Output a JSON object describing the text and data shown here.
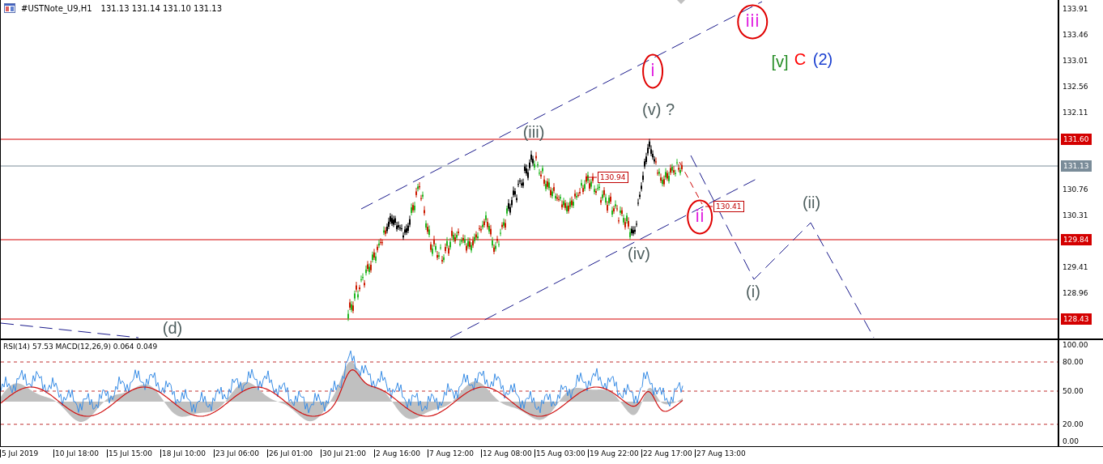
{
  "header": {
    "title": "#USTNote_U9,H1",
    "quote": "131.13 131.14 131.10 131.13"
  },
  "price_axis": [
    "133.91",
    "133.46",
    "133.01",
    "132.56",
    "132.11",
    "130.76",
    "130.31",
    "129.41",
    "128.96"
  ],
  "levels": [
    {
      "label": "131.60",
      "kind": "resistance"
    },
    {
      "label": "131.13",
      "kind": "current"
    },
    {
      "label": "129.84",
      "kind": "support"
    },
    {
      "label": "128.43",
      "kind": "support"
    }
  ],
  "price_tags": [
    "130.94",
    "130.41"
  ],
  "wave_labels": [
    {
      "text": "(iii)",
      "color": "#4f5f5f",
      "circled": false
    },
    {
      "text": "(v) ?",
      "color": "#4f5f5f",
      "circled": false
    },
    {
      "text": "(iv)",
      "color": "#4f5f5f",
      "circled": false
    },
    {
      "text": "i",
      "color": "#e020e0",
      "circled": true
    },
    {
      "text": "ii",
      "color": "#e020e0",
      "circled": true
    },
    {
      "text": "iii",
      "color": "#e020e0",
      "circled": true
    },
    {
      "text": "[v]",
      "color": "#228b22",
      "circled": false
    },
    {
      "text": "C",
      "color": "#ff0000",
      "circled": false
    },
    {
      "text": "(2)",
      "color": "#1a3fd0",
      "circled": false
    },
    {
      "text": "(ii)",
      "color": "#4f5f5f",
      "circled": false
    },
    {
      "text": "(i)",
      "color": "#4f5f5f",
      "circled": false
    },
    {
      "text": "(d)",
      "color": "#4f5f5f",
      "circled": false
    }
  ],
  "indicator": {
    "legend": "RSI(14) 57.53 MACD(12,26,9) 0.064 0.049",
    "ticks": [
      "100.00",
      "80.00",
      "50.00",
      "20.00",
      "0.00"
    ]
  },
  "time_axis": [
    "5 Jul 2019",
    "10 Jul 18:00",
    "15 Jul 15:00",
    "18 Jul 10:00",
    "23 Jul 06:00",
    "26 Jul 01:00",
    "30 Jul 21:00",
    "2 Aug 16:00",
    "7 Aug 12:00",
    "12 Aug 08:00",
    "15 Aug 03:00",
    "19 Aug 22:00",
    "22 Aug 17:00",
    "27 Aug 13:00"
  ]
}
